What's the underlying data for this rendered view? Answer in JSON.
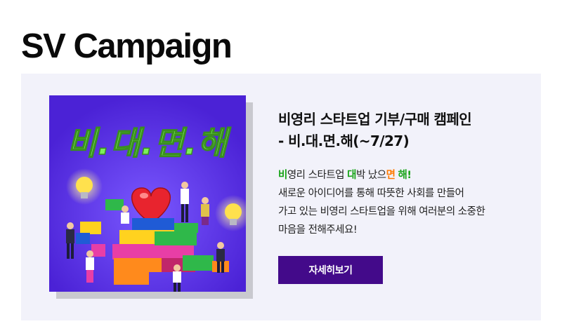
{
  "page": {
    "title": "SV Campaign"
  },
  "campaign": {
    "image_text": "비.대.면.해",
    "title_line1": "비영리 스타트업 기부/구매 캠페인",
    "title_line2": "- 비.대.면.해(~7/27)",
    "tagline": {
      "p1": "비",
      "p2": "영리 스타트업 ",
      "p3": "대",
      "p4": "박 났으",
      "p5": "면",
      "p6": " ",
      "p7": "해!"
    },
    "body_lines": [
      "새로운 아이디어를 통해 따뜻한 사회를 만들어",
      "가고 있는 비영리 스타트업을 위해 여러분의 소중한",
      "마음을 전해주세요!"
    ],
    "button_label": "자세히보기"
  },
  "colors": {
    "image_bg": "#5d36e6",
    "image_text": "#7cf05a",
    "button_bg": "#430a8a",
    "accent_green": "#17a317",
    "accent_orange": "#ff7a00",
    "card_bg": "#f2f2fa"
  },
  "icons": [
    "heart-icon",
    "lightbulb-icon",
    "lego-block-icon",
    "person-figure-icon"
  ]
}
